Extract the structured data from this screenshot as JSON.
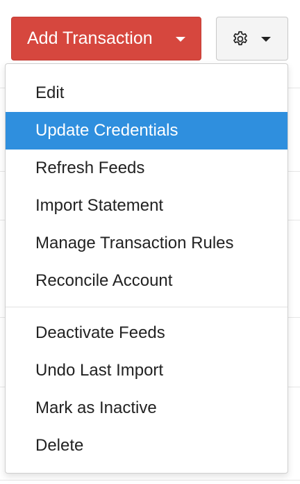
{
  "toolbar": {
    "add_transaction_label": "Add Transaction",
    "add_transaction_color": "#d6473e",
    "settings_icon": "gear-icon",
    "caret_icon": "caret-down-icon"
  },
  "menu": {
    "highlight_color": "#2f8fde",
    "group1": [
      {
        "label": "Edit",
        "active": false
      },
      {
        "label": "Update Credentials",
        "active": true
      },
      {
        "label": "Refresh Feeds",
        "active": false
      },
      {
        "label": "Import Statement",
        "active": false
      },
      {
        "label": "Manage Transaction Rules",
        "active": false
      },
      {
        "label": "Reconcile Account",
        "active": false
      }
    ],
    "group2": [
      {
        "label": "Deactivate Feeds",
        "active": false
      },
      {
        "label": "Undo Last Import",
        "active": false
      },
      {
        "label": "Mark as Inactive",
        "active": false
      },
      {
        "label": "Delete",
        "active": false
      }
    ]
  }
}
